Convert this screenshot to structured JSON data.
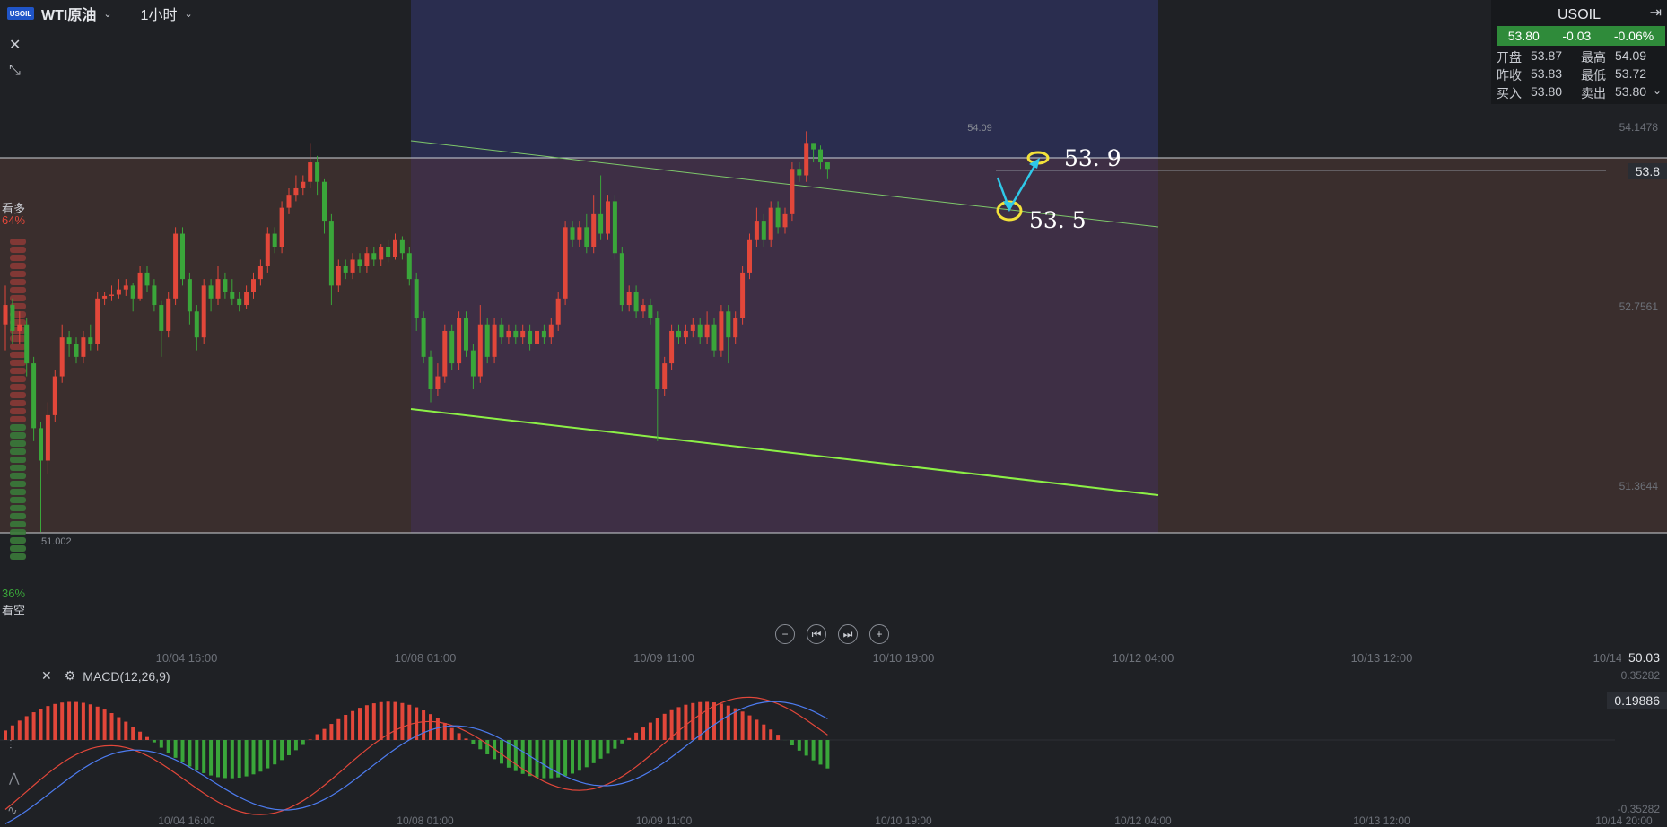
{
  "header": {
    "logo_text": "USOIL",
    "symbol": "WTI原油",
    "timeframe": "1小时",
    "chevron": "⌄"
  },
  "left_icons": {
    "close": "✕",
    "collapse": "⤡"
  },
  "quote_panel": {
    "title": "USOIL",
    "last": "53.80",
    "change": "-0.03",
    "change_pct": "-0.06%",
    "open_label": "开盘",
    "open": "53.87",
    "high_label": "最高",
    "high": "54.09",
    "prev_label": "昨收",
    "prev": "53.83",
    "low_label": "最低",
    "low": "53.72",
    "bid_label": "买入",
    "bid": "53.80",
    "ask_label": "卖出",
    "ask": "53.80"
  },
  "sentiment": {
    "long_label": "看多",
    "long_pct": "64%",
    "short_label": "看空",
    "short_pct": "36%"
  },
  "nav_buttons": {
    "zoom_out": "−",
    "prev": "⏮",
    "next": "⏭",
    "zoom_in": "+"
  },
  "macd": {
    "label": "MACD(12,26,9)",
    "close": "✕",
    "settings": "⚙"
  },
  "colors": {
    "up": "#e2473a",
    "down": "#3aa63a",
    "macd_line": "#e2473a",
    "signal_line": "#4d7cf0",
    "trendline": "#8cf046",
    "annotation": "#f3e23a",
    "arrow": "#2fc8e8"
  },
  "chart_data": {
    "type": "candlestick",
    "price_axis_ticks": [
      "54.1478",
      "52.7561",
      "51.3644"
    ],
    "current_price_label": "53.8",
    "high_label": "54.09",
    "low_label": "51.002",
    "time_ticks": [
      "10/04 16:00",
      "10/08 01:00",
      "10/09 11:00",
      "10/10 19:00",
      "10/12 04:00",
      "10/13 12:00",
      "10/14 20:00"
    ],
    "ylim": [
      51.0,
      54.3
    ],
    "candles": [
      [
        52.6,
        52.75,
        52.9,
        52.4
      ],
      [
        52.75,
        52.55,
        52.8,
        52.45
      ],
      [
        52.55,
        52.6,
        52.7,
        52.45
      ],
      [
        52.6,
        52.3,
        52.65,
        52.2
      ],
      [
        52.3,
        51.8,
        52.35,
        51.7
      ],
      [
        51.8,
        51.55,
        51.85,
        51.0
      ],
      [
        51.55,
        51.9,
        52.0,
        51.45
      ],
      [
        51.9,
        52.2,
        52.25,
        51.85
      ],
      [
        52.2,
        52.5,
        52.6,
        52.15
      ],
      [
        52.5,
        52.45,
        52.55,
        52.35
      ],
      [
        52.45,
        52.35,
        52.5,
        52.3
      ],
      [
        52.35,
        52.5,
        52.55,
        52.3
      ],
      [
        52.5,
        52.45,
        52.6,
        52.4
      ],
      [
        52.45,
        52.8,
        52.85,
        52.4
      ],
      [
        52.8,
        52.82,
        52.85,
        52.75
      ],
      [
        52.82,
        52.83,
        52.9,
        52.78
      ],
      [
        52.83,
        52.87,
        52.95,
        52.8
      ],
      [
        52.87,
        52.9,
        52.95,
        52.82
      ],
      [
        52.9,
        52.8,
        52.92,
        52.7
      ],
      [
        52.8,
        53.0,
        53.05,
        52.78
      ],
      [
        53.0,
        52.9,
        53.05,
        52.85
      ],
      [
        52.9,
        52.75,
        52.95,
        52.7
      ],
      [
        52.75,
        52.55,
        52.78,
        52.35
      ],
      [
        52.55,
        52.8,
        52.85,
        52.5
      ],
      [
        52.8,
        53.3,
        53.35,
        52.75
      ],
      [
        53.3,
        52.95,
        53.35,
        52.9
      ],
      [
        52.95,
        52.7,
        53.0,
        52.6
      ],
      [
        52.7,
        52.5,
        52.75,
        52.4
      ],
      [
        52.5,
        52.9,
        52.95,
        52.45
      ],
      [
        52.9,
        52.8,
        52.95,
        52.7
      ],
      [
        52.8,
        52.95,
        53.05,
        52.75
      ],
      [
        52.95,
        52.85,
        53.0,
        52.8
      ],
      [
        52.85,
        52.8,
        52.95,
        52.75
      ],
      [
        52.8,
        52.75,
        52.85,
        52.7
      ],
      [
        52.75,
        52.85,
        52.9,
        52.72
      ],
      [
        52.85,
        52.95,
        53.0,
        52.8
      ],
      [
        52.95,
        53.05,
        53.1,
        52.9
      ],
      [
        53.05,
        53.3,
        53.35,
        53.0
      ],
      [
        53.3,
        53.2,
        53.35,
        53.15
      ],
      [
        53.2,
        53.5,
        53.55,
        53.15
      ],
      [
        53.5,
        53.6,
        53.65,
        53.45
      ],
      [
        53.6,
        53.65,
        53.75,
        53.55
      ],
      [
        53.65,
        53.7,
        53.75,
        53.6
      ],
      [
        53.7,
        53.85,
        54.0,
        53.65
      ],
      [
        53.85,
        53.7,
        53.9,
        53.6
      ],
      [
        53.7,
        53.4,
        53.72,
        53.3
      ],
      [
        53.4,
        52.9,
        53.45,
        52.75
      ],
      [
        52.9,
        53.05,
        53.1,
        52.85
      ],
      [
        53.05,
        53.0,
        53.1,
        52.95
      ],
      [
        53.0,
        53.1,
        53.15,
        52.95
      ],
      [
        53.1,
        53.05,
        53.15,
        53.0
      ],
      [
        53.05,
        53.15,
        53.2,
        53.0
      ],
      [
        53.15,
        53.1,
        53.2,
        53.05
      ],
      [
        53.1,
        53.2,
        53.22,
        53.05
      ],
      [
        53.2,
        53.12,
        53.25,
        53.08
      ],
      [
        53.12,
        53.25,
        53.3,
        53.1
      ],
      [
        53.25,
        53.15,
        53.28,
        53.1
      ],
      [
        53.15,
        52.95,
        53.2,
        52.9
      ],
      [
        52.95,
        52.65,
        53.0,
        52.55
      ],
      [
        52.65,
        52.35,
        52.7,
        52.3
      ],
      [
        52.35,
        52.1,
        52.4,
        52.0
      ],
      [
        52.1,
        52.2,
        52.3,
        52.05
      ],
      [
        52.2,
        52.55,
        52.6,
        52.15
      ],
      [
        52.55,
        52.3,
        52.6,
        52.25
      ],
      [
        52.3,
        52.65,
        52.7,
        52.25
      ],
      [
        52.65,
        52.4,
        52.7,
        52.35
      ],
      [
        52.4,
        52.2,
        52.45,
        52.1
      ],
      [
        52.2,
        52.6,
        52.75,
        52.15
      ],
      [
        52.6,
        52.35,
        52.65,
        52.3
      ],
      [
        52.35,
        52.6,
        52.65,
        52.3
      ],
      [
        52.6,
        52.5,
        52.65,
        52.45
      ],
      [
        52.5,
        52.55,
        52.6,
        52.45
      ],
      [
        52.55,
        52.5,
        52.6,
        52.45
      ],
      [
        52.5,
        52.55,
        52.6,
        52.45
      ],
      [
        52.55,
        52.45,
        52.6,
        52.4
      ],
      [
        52.45,
        52.55,
        52.6,
        52.4
      ],
      [
        52.55,
        52.5,
        52.6,
        52.45
      ],
      [
        52.5,
        52.6,
        52.65,
        52.45
      ],
      [
        52.6,
        52.8,
        52.85,
        52.55
      ],
      [
        52.8,
        53.35,
        53.4,
        52.75
      ],
      [
        53.35,
        53.25,
        53.4,
        53.2
      ],
      [
        53.25,
        53.35,
        53.4,
        53.2
      ],
      [
        53.35,
        53.2,
        53.45,
        53.15
      ],
      [
        53.2,
        53.45,
        53.6,
        53.15
      ],
      [
        53.45,
        53.3,
        53.75,
        53.25
      ],
      [
        53.3,
        53.55,
        53.6,
        53.25
      ],
      [
        53.55,
        53.15,
        53.6,
        53.1
      ],
      [
        53.15,
        52.75,
        53.2,
        52.7
      ],
      [
        52.75,
        52.85,
        52.9,
        52.7
      ],
      [
        52.85,
        52.7,
        52.9,
        52.65
      ],
      [
        52.7,
        52.75,
        52.8,
        52.65
      ],
      [
        52.75,
        52.65,
        52.8,
        52.6
      ],
      [
        52.65,
        52.1,
        52.7,
        51.7
      ],
      [
        52.1,
        52.3,
        52.35,
        52.05
      ],
      [
        52.3,
        52.55,
        52.6,
        52.25
      ],
      [
        52.55,
        52.5,
        52.6,
        52.45
      ],
      [
        52.5,
        52.55,
        52.6,
        52.45
      ],
      [
        52.55,
        52.6,
        52.65,
        52.5
      ],
      [
        52.6,
        52.5,
        52.65,
        52.45
      ],
      [
        52.5,
        52.6,
        52.7,
        52.45
      ],
      [
        52.6,
        52.4,
        52.65,
        52.35
      ],
      [
        52.4,
        52.7,
        52.75,
        52.35
      ],
      [
        52.7,
        52.5,
        52.75,
        52.3
      ],
      [
        52.5,
        52.65,
        52.7,
        52.45
      ],
      [
        52.65,
        53.0,
        53.05,
        52.6
      ],
      [
        53.0,
        53.25,
        53.3,
        52.95
      ],
      [
        53.25,
        53.4,
        53.5,
        53.2
      ],
      [
        53.4,
        53.25,
        53.45,
        53.2
      ],
      [
        53.25,
        53.5,
        53.55,
        53.2
      ],
      [
        53.5,
        53.35,
        53.55,
        53.3
      ],
      [
        53.35,
        53.45,
        53.5,
        53.3
      ],
      [
        53.45,
        53.8,
        53.85,
        53.4
      ],
      [
        53.8,
        53.75,
        53.85,
        53.7
      ],
      [
        53.75,
        54.0,
        54.09,
        53.7
      ],
      [
        54.0,
        53.95,
        54.0,
        53.85
      ],
      [
        53.95,
        53.85,
        53.98,
        53.8
      ],
      [
        53.85,
        53.8,
        53.85,
        53.72
      ]
    ],
    "annotations": [
      {
        "text": "53. 9",
        "price": 53.9
      },
      {
        "text": "53. 5",
        "price": 53.5
      }
    ],
    "macd_axis_ticks": [
      "0.35282",
      "0.19886",
      "-0.35282"
    ],
    "macd_price_label": "50.03"
  }
}
